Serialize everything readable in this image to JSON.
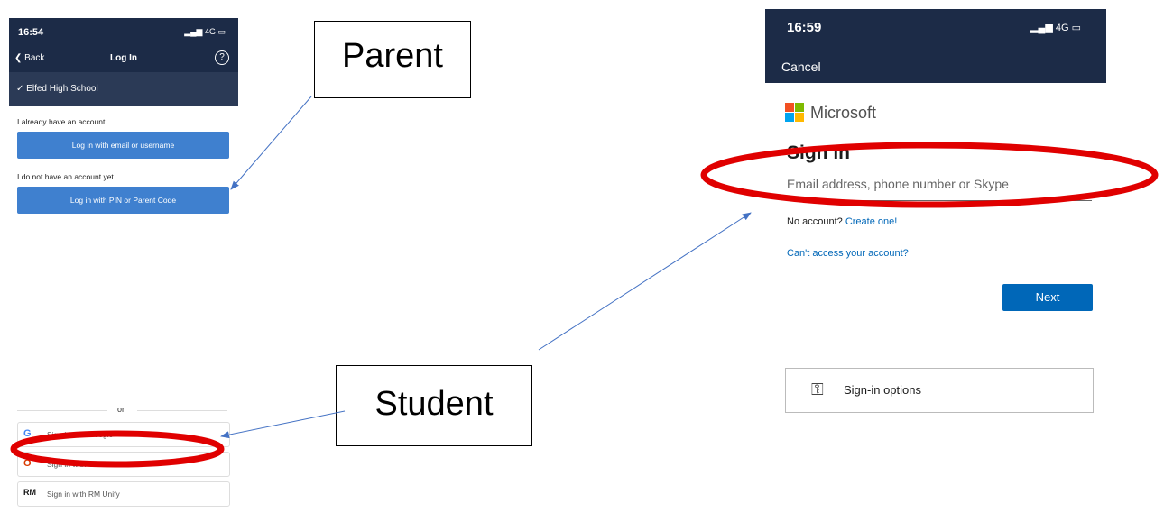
{
  "left_phone": {
    "time": "16:54",
    "signal": "4G",
    "back_label": "Back",
    "title": "Log In",
    "help_icon": "?",
    "school": "Elfed High School",
    "have_account_label": "I already have an account",
    "login_email_button": "Log in with email or username",
    "no_account_label": "I do not have an account yet",
    "login_pin_button": "Log in with PIN or Parent Code",
    "or_label": "or",
    "sso_options": [
      {
        "icon": "G",
        "label": "Sign in with Google"
      },
      {
        "icon": "O",
        "label": "Sign in with Office 365"
      },
      {
        "icon": "RM",
        "label": "Sign in with RM Unify"
      }
    ]
  },
  "callouts": {
    "parent": "Parent",
    "student": "Student"
  },
  "right_phone": {
    "time": "16:59",
    "signal": "4G",
    "cancel_label": "Cancel",
    "brand": "Microsoft",
    "heading": "Sign in",
    "email_placeholder": "Email address, phone number or Skype",
    "no_account_text": "No account?",
    "create_link": "Create one!",
    "cant_access_link": "Can't access your account?",
    "next_button": "Next",
    "signin_options": "Sign-in options"
  },
  "colors": {
    "header_bg": "#1c2b47",
    "button_blue": "#3f80cf",
    "ms_blue": "#0067b8",
    "highlight_red": "#e00000",
    "arrow": "#4472c4"
  }
}
